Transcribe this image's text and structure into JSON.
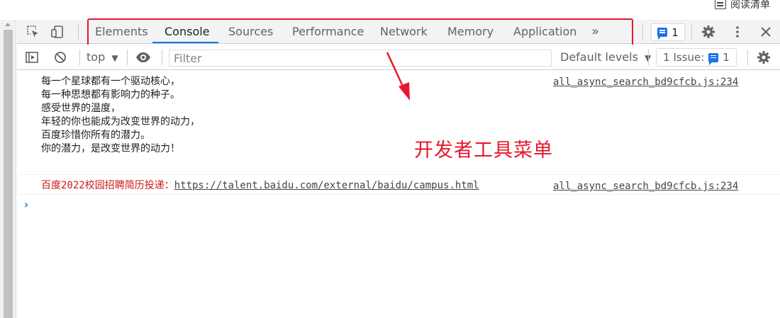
{
  "browser": {
    "reading_list_label": "阅读清单"
  },
  "devtools": {
    "tabs": [
      {
        "label": "Elements"
      },
      {
        "label": "Console"
      },
      {
        "label": "Sources"
      },
      {
        "label": "Performance"
      },
      {
        "label": "Network"
      },
      {
        "label": "Memory"
      },
      {
        "label": "Application"
      }
    ],
    "active_tab": "Console",
    "more_tabs_glyph": "»",
    "message_count": "1",
    "accent_color": "#1a73e8"
  },
  "toolbar": {
    "context": "top",
    "filter_placeholder": "Filter",
    "levels": "Default levels",
    "issues_label": "1 Issue:",
    "issues_count": "1"
  },
  "console": {
    "messages": [
      {
        "lines": "每一个星球都有一个驱动核心，\n每一种思想都有影响力的种子。\n感受世界的温度，\n年轻的你也能成为改变世界的动力，\n百度珍惜你所有的潜力。\n你的潜力，是改变世界的动力！",
        "source": "all_async_search_bd9cfcb.js:234"
      },
      {
        "prefix": "百度2022校园招聘简历投递：",
        "link": "https://talent.baidu.com/external/baidu/campus.html",
        "source": "all_async_search_bd9cfcb.js:234"
      }
    ]
  },
  "annotation": {
    "text": "开发者工具菜单",
    "color": "#e8162a"
  }
}
